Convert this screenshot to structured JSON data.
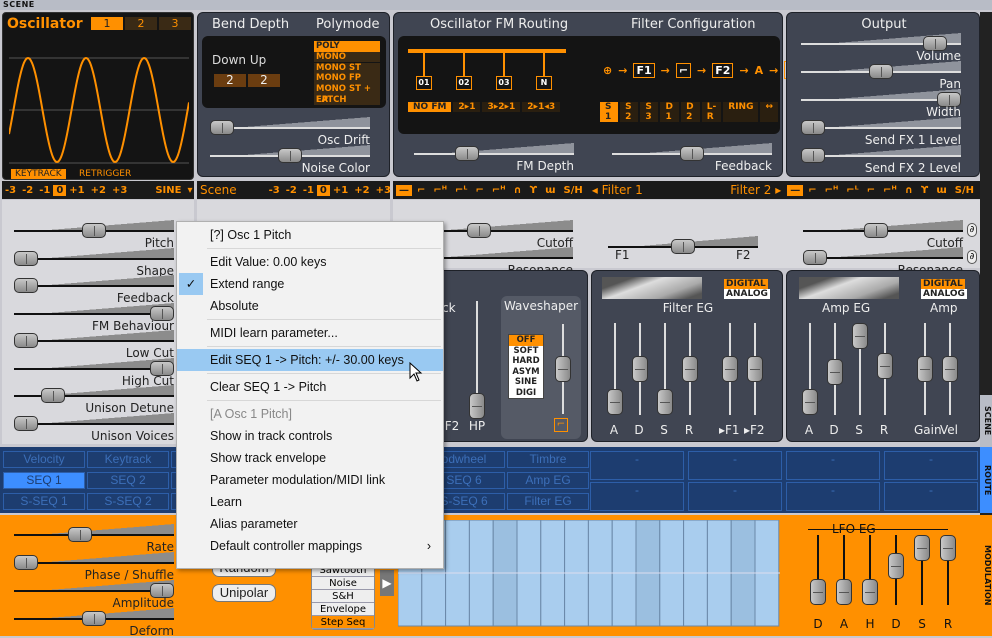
{
  "side_tabs": {
    "scene": "SCENE",
    "route": "ROUTE",
    "modulation": "MODULATION"
  },
  "oscillator": {
    "title": "Oscillator",
    "tabs": [
      "1",
      "2",
      "3"
    ],
    "selected_tab": "1",
    "keytrack": "KEYTRACK",
    "retrigger": "RETRIGGER",
    "octave_options": [
      "-3",
      "-2",
      "-1",
      "0",
      "+1",
      "+2",
      "+3"
    ],
    "octave_selected": "0",
    "waveform": "SINE",
    "params": [
      {
        "label": "Pitch",
        "value": 0.5
      },
      {
        "label": "Shape",
        "value": 0.0
      },
      {
        "label": "Feedback",
        "value": 0.0
      },
      {
        "label": "FM Behaviour",
        "value": 1.0
      },
      {
        "label": "Low Cut",
        "value": 0.0
      },
      {
        "label": "High Cut",
        "value": 1.0
      },
      {
        "label": "Unison Detune",
        "value": 0.2
      },
      {
        "label": "Unison Voices",
        "value": 0.0
      }
    ]
  },
  "bend_poly": {
    "bend_title": "Bend Depth",
    "poly_title": "Polymode",
    "down_up_label": "Down Up",
    "down": "2",
    "up": "2",
    "polymodes": [
      "POLY",
      "MONO",
      "MONO ST",
      "MONO FP",
      "MONO ST + FP",
      "LATCH"
    ],
    "polymode_selected": "POLY",
    "osc_drift": {
      "label": "Osc Drift",
      "value": 0.0
    },
    "noise_color": {
      "label": "Noise Color",
      "value": 0.5
    }
  },
  "scene": {
    "title": "Scene",
    "octave_options": [
      "-3",
      "-2",
      "-1",
      "0",
      "+1",
      "+2",
      "+3"
    ],
    "octave_selected": "0"
  },
  "fm_routing": {
    "title": "Oscillator FM Routing",
    "boxes": [
      "01",
      "02",
      "03",
      "N"
    ],
    "modes": [
      "NO FM",
      "2▸1",
      "3▸2▸1",
      "2▸1◂3"
    ],
    "mode_selected": "NO FM",
    "fm_depth": {
      "label": "FM Depth",
      "value": 0.3
    }
  },
  "filter_config": {
    "title": "Filter Configuration",
    "chain": [
      "⊕",
      "F1",
      "⌐",
      "F2",
      "A",
      "⌒"
    ],
    "modes": [
      "S 1",
      "S 2",
      "S 3",
      "D 1",
      "D 2",
      "L-R",
      "RING",
      "↔"
    ],
    "mode_selected": "S 1",
    "feedback": {
      "label": "Feedback",
      "value": 0.5
    }
  },
  "output": {
    "title": "Output",
    "params": [
      {
        "label": "Volume",
        "value": 0.9
      },
      {
        "label": "Pan",
        "value": 0.5
      },
      {
        "label": "Width",
        "value": 1.0
      },
      {
        "label": "Send FX 1 Level",
        "value": 0.0
      },
      {
        "label": "Send FX 2 Level",
        "value": 0.0
      }
    ]
  },
  "filter_bar": {
    "filter1": "◂ Filter 1",
    "filter2": "Filter 2 ▸",
    "types": [
      "—",
      "⌐",
      "⌐ᴴ",
      "⌐ᴸ",
      "⌐",
      "⌐ᴴ",
      "∩",
      "ϒ",
      "ɯ",
      "S/H"
    ]
  },
  "filter1": {
    "cutoff": {
      "label": "Cutoff",
      "value": 0.4
    },
    "resonance": {
      "label": "Resonance",
      "value": 0.0
    }
  },
  "filter_balance": {
    "left": "F1",
    "right": "F2",
    "value": 0.5
  },
  "filter2": {
    "cutoff": {
      "label": "Cutoff",
      "value": 0.45
    },
    "resonance": {
      "label": "Resonance",
      "value": 0.0
    }
  },
  "mixer": {
    "partial_label": "ck",
    "labels": [
      "F2",
      "HP"
    ]
  },
  "waveshaper": {
    "title": "Waveshaper",
    "options": [
      "OFF",
      "SOFT",
      "HARD",
      "ASYM",
      "SINE",
      "DIGI"
    ],
    "selected": "OFF"
  },
  "filter_eg": {
    "title": "Filter EG",
    "mode_digital": "DIGITAL",
    "mode_analog": "ANALOG",
    "sliders": [
      {
        "label": "A",
        "value": 0.0
      },
      {
        "label": "D",
        "value": 0.5
      },
      {
        "label": "S",
        "value": 0.0
      },
      {
        "label": "R",
        "value": 0.5
      },
      {
        "label": "▸F1",
        "value": 0.5
      },
      {
        "label": "▸F2",
        "value": 0.5
      }
    ]
  },
  "amp_eg": {
    "title": "Amp EG",
    "amp_title": "Amp",
    "mode_digital": "DIGITAL",
    "mode_analog": "ANALOG",
    "sliders": [
      {
        "label": "A",
        "value": 0.0
      },
      {
        "label": "D",
        "value": 0.45
      },
      {
        "label": "S",
        "value": 1.0
      },
      {
        "label": "R",
        "value": 0.55
      },
      {
        "label": "Gain",
        "value": 0.5
      },
      {
        "label": "Vel",
        "value": 0.5
      }
    ]
  },
  "route": {
    "rows": [
      [
        "Velocity",
        "Keytrack",
        "",
        "",
        "",
        "odwheel",
        "Timbre"
      ],
      [
        "SEQ 1",
        "SEQ 2",
        "",
        "",
        "",
        "SEQ 6",
        "Amp EG"
      ],
      [
        "S-SEQ 1",
        "S-SEQ 2",
        "",
        "",
        "",
        "S-SEQ 6",
        "Filter EG"
      ]
    ],
    "selected": "SEQ 1",
    "macro_slots": [
      "-",
      "-",
      "-",
      "-",
      "-",
      "-",
      "-",
      "-"
    ]
  },
  "lfo": {
    "params": [
      {
        "label": "Rate",
        "value": 0.4
      },
      {
        "label": "Phase / Shuffle",
        "value": 0.0
      },
      {
        "label": "Amplitude",
        "value": 1.0
      },
      {
        "label": "Deform",
        "value": 0.5
      }
    ],
    "random_label": "Random",
    "unipolar_label": "Unipolar",
    "shapes": [
      "Sawtooth",
      "Noise",
      "S&H",
      "Envelope",
      "Step Seq"
    ],
    "shape_selected": "Step Seq",
    "eg_title": "LFO EG",
    "eg_sliders": [
      {
        "label": "D",
        "value": 0.0
      },
      {
        "label": "A",
        "value": 0.0
      },
      {
        "label": "H",
        "value": 0.0
      },
      {
        "label": "D",
        "value": 0.6
      },
      {
        "label": "S",
        "value": 1.0
      },
      {
        "label": "R",
        "value": 1.0
      }
    ]
  },
  "context_menu": {
    "items": [
      {
        "label": "[?] Osc 1 Pitch",
        "type": "item"
      },
      {
        "type": "separator"
      },
      {
        "label": "Edit Value: 0.00 keys",
        "type": "item"
      },
      {
        "label": "Extend range",
        "type": "item",
        "checked": true
      },
      {
        "label": "Absolute",
        "type": "item"
      },
      {
        "type": "separator"
      },
      {
        "label": "MIDI learn parameter...",
        "type": "item"
      },
      {
        "type": "separator"
      },
      {
        "label": "Edit SEQ 1 -> Pitch: +/- 30.00 keys",
        "type": "item",
        "highlighted": true
      },
      {
        "type": "separator"
      },
      {
        "label": "Clear SEQ 1 -> Pitch",
        "type": "item"
      },
      {
        "type": "separator"
      },
      {
        "label": "[A Osc 1 Pitch]",
        "type": "disabled"
      },
      {
        "label": "Show in track controls",
        "type": "item"
      },
      {
        "label": "Show track envelope",
        "type": "item"
      },
      {
        "label": "Parameter modulation/MIDI link",
        "type": "item"
      },
      {
        "label": "Learn",
        "type": "item"
      },
      {
        "label": "Alias parameter",
        "type": "item"
      },
      {
        "label": "Default controller mappings",
        "type": "submenu"
      }
    ],
    "check_icon": "✓",
    "submenu_icon": "›"
  },
  "colors": {
    "accent": "#ff9000",
    "route_bg": "#1d3d70",
    "menu_highlight": "#99c9f2",
    "panel_bg": "#404552"
  }
}
